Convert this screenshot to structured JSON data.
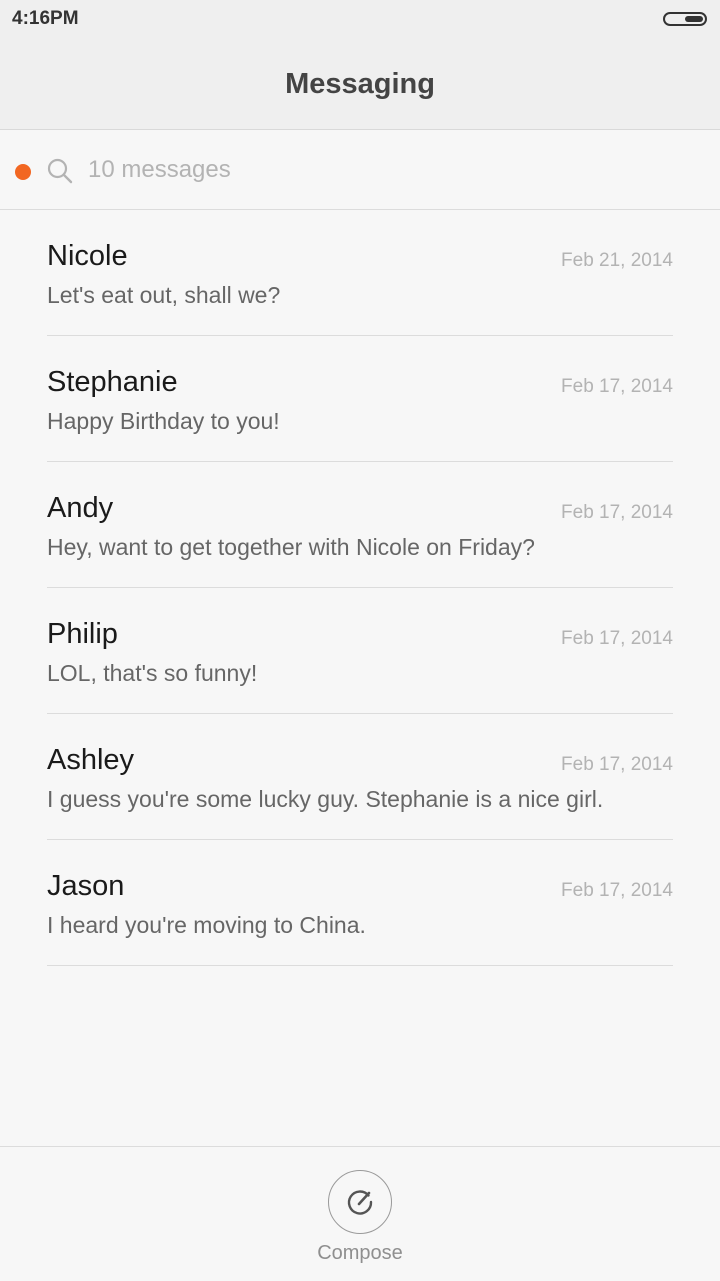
{
  "status_bar": {
    "time": "4:16PM"
  },
  "header": {
    "title": "Messaging"
  },
  "search": {
    "placeholder": "10 messages",
    "icon": "search-icon"
  },
  "conversations": [
    {
      "name": "Nicole",
      "preview": "Let's eat out, shall we?",
      "date": "Feb 21, 2014",
      "unread": false
    },
    {
      "name": "Stephanie",
      "preview": "Happy Birthday to you!",
      "date": "Feb 17, 2014",
      "unread": true
    },
    {
      "name": "Andy",
      "preview": "Hey, want to get together with Nicole on Friday?",
      "date": "Feb 17, 2014",
      "unread": false
    },
    {
      "name": "Philip",
      "preview": "LOL, that's so funny!",
      "date": "Feb 17, 2014",
      "unread": false
    },
    {
      "name": "Ashley",
      "preview": "I guess you're some lucky guy. Stephanie is a nice girl.",
      "date": "Feb 17, 2014",
      "unread": false
    },
    {
      "name": "Jason",
      "preview": "I heard you're moving to China.",
      "date": "Feb 17, 2014",
      "unread": false
    }
  ],
  "compose": {
    "label": "Compose",
    "icon": "compose-icon"
  },
  "colors": {
    "unread_accent": "#f26722",
    "background": "#f7f7f7",
    "header_background": "#efefef"
  }
}
